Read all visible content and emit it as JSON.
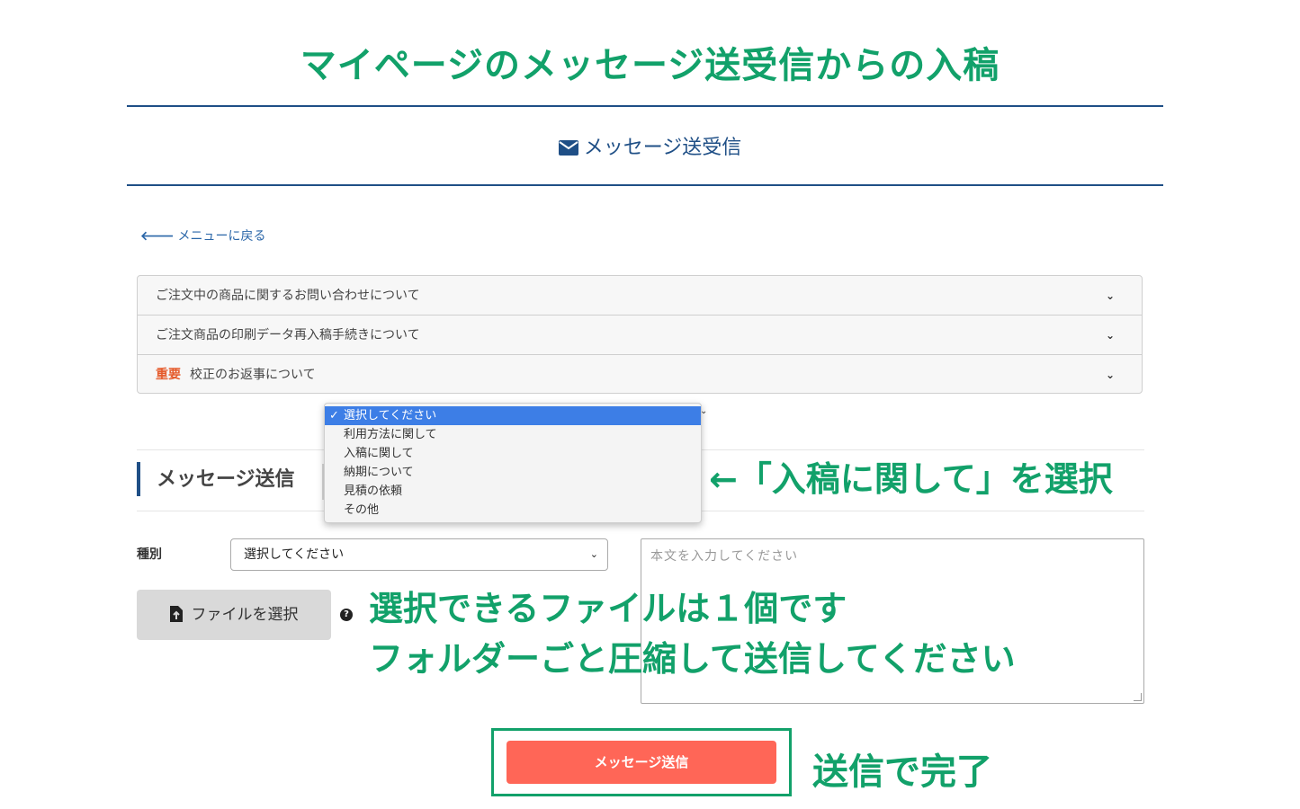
{
  "annotation_title": "マイページのメッセージ送受信からの入稿",
  "header": {
    "icon": "envelope-icon",
    "title": "メッセージ送受信"
  },
  "back_link": {
    "icon": "arrow-left-icon",
    "label": "メニューに戻る"
  },
  "accordion": {
    "items": [
      {
        "badge": "",
        "label": "ご注文中の商品に関するお問い合わせについて"
      },
      {
        "badge": "",
        "label": "ご注文商品の印刷データ再入稿手続きについて"
      },
      {
        "badge": "重要",
        "label": "校正のお返事について"
      }
    ]
  },
  "section": {
    "title": "メッセージ送信"
  },
  "dropdown": {
    "options": [
      "選択してください",
      "利用方法に関して",
      "入稿に関して",
      "納期について",
      "見積の依頼",
      "その他"
    ],
    "selected_index": 0
  },
  "form": {
    "kind_label": "種別",
    "kind_value": "選択してください",
    "body_placeholder": "本文を入力してください",
    "file_button_label": "ファイルを選択",
    "help_glyph": "?",
    "submit_label": "メッセージ送信"
  },
  "annotations": {
    "select_hint": "←「入稿に関して」を選択",
    "file_hint_1": "選択できるファイルは１個です",
    "file_hint_2": "フォルダーごと圧縮して送信してください",
    "done_hint": "送信で完了"
  },
  "colors": {
    "annotation_green": "#12a16a",
    "navy": "#1f4f86",
    "submit_red": "#ff6657",
    "important_orange": "#e55a2b",
    "dropdown_selected": "#3d7ee6"
  }
}
